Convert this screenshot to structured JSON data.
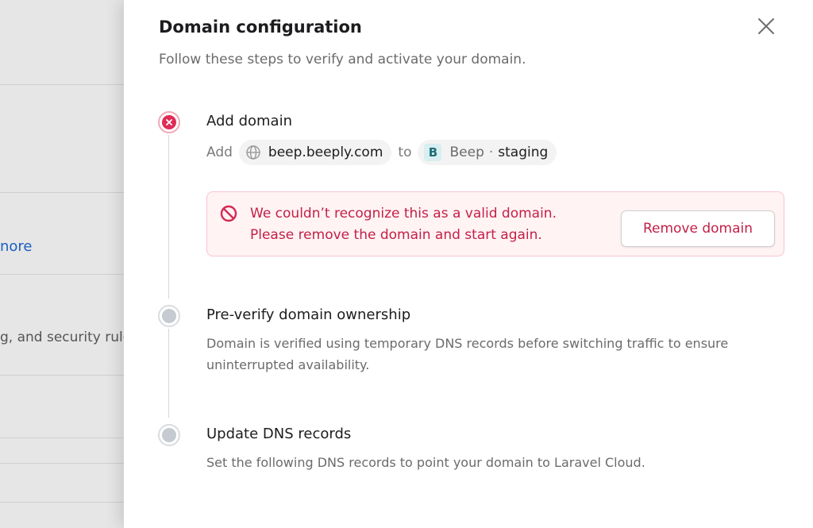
{
  "background": {
    "link_fragment": "nore",
    "text_fragment": "g, and security rule"
  },
  "drawer": {
    "title": "Domain configuration",
    "subtitle": "Follow these steps to verify and activate your domain.",
    "close_icon": "close-icon"
  },
  "steps": [
    {
      "title": "Add domain",
      "status": "error",
      "add_prefix": "Add",
      "domain": "beep.beeply.com",
      "to_label": "to",
      "project_badge": "B",
      "project_name": "Beep",
      "separator": "·",
      "environment": "staging",
      "error": {
        "line1": "We couldn’t recognize this as a valid domain.",
        "line2": "Please remove the domain and start again.",
        "button_label": "Remove domain"
      }
    },
    {
      "title": "Pre-verify domain ownership",
      "status": "pending",
      "description_line1": "Domain is verified using temporary DNS records before switching traffic to ensure",
      "description_line2": "uninterrupted availability."
    },
    {
      "title": "Update DNS records",
      "status": "pending",
      "description": "Set the following DNS records to point your domain to Laravel Cloud."
    }
  ],
  "colors": {
    "error": "#df2b56",
    "error_text": "#c41f45",
    "pending": "#c5cbd1",
    "link": "#1b5fc0"
  }
}
